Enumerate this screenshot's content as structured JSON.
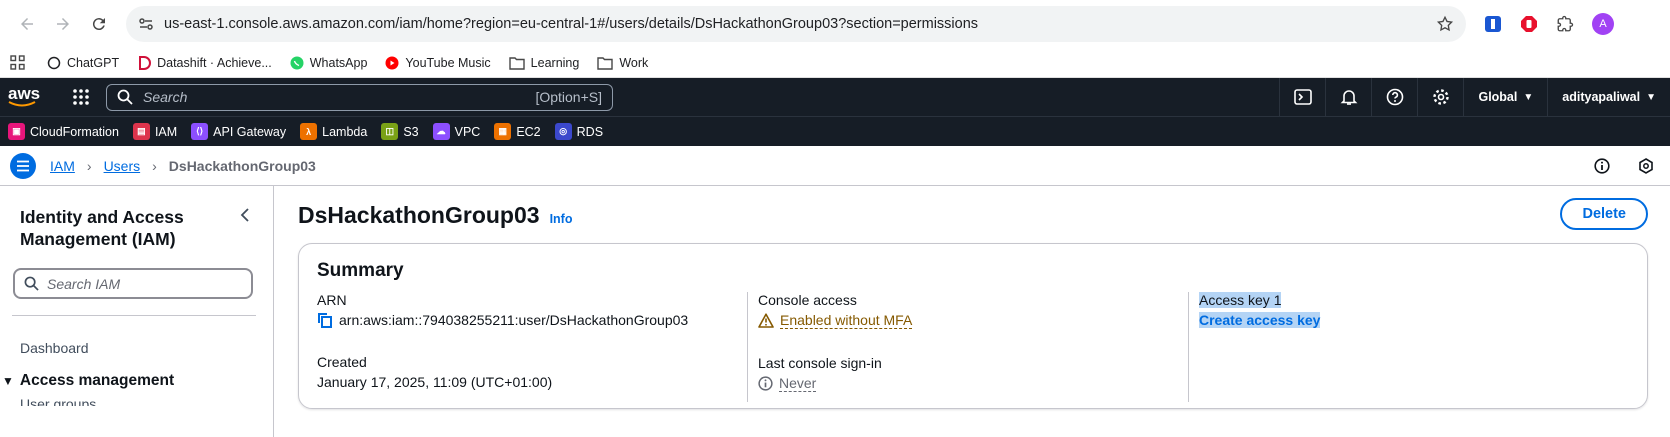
{
  "browser": {
    "url": "us-east-1.console.aws.amazon.com/iam/home?region=eu-central-1#/users/details/DsHackathonGroup03?section=permissions",
    "avatar_letter": "A"
  },
  "bookmarks": [
    "ChatGPT",
    "Datashift · Achieve...",
    "WhatsApp",
    "YouTube Music",
    "Learning",
    "Work"
  ],
  "aws": {
    "logo": "aws",
    "search_placeholder": "Search",
    "search_shortcut": "[Option+S]",
    "region": "Global",
    "user": "adityapaliwal",
    "favorites": [
      {
        "label": "CloudFormation",
        "color": "#e7157b"
      },
      {
        "label": "IAM",
        "color": "#dd344c"
      },
      {
        "label": "API Gateway",
        "color": "#8c4fff"
      },
      {
        "label": "Lambda",
        "color": "#ed7100"
      },
      {
        "label": "S3",
        "color": "#7aa116"
      },
      {
        "label": "VPC",
        "color": "#8c4fff"
      },
      {
        "label": "EC2",
        "color": "#ed7100"
      },
      {
        "label": "RDS",
        "color": "#3b48cc"
      }
    ]
  },
  "breadcrumb": {
    "items": [
      "IAM",
      "Users"
    ],
    "current": "DsHackathonGroup03"
  },
  "sidebar": {
    "title": "Identity and Access Management (IAM)",
    "search_placeholder": "Search IAM",
    "dashboard": "Dashboard",
    "section": "Access management",
    "sub_item": "User groups"
  },
  "page": {
    "title": "DsHackathonGroup03",
    "info": "Info",
    "delete_label": "Delete"
  },
  "summary": {
    "title": "Summary",
    "arn_label": "ARN",
    "arn_value": "arn:aws:iam::794038255211:user/DsHackathonGroup03",
    "created_label": "Created",
    "created_value": "January 17, 2025, 11:09 (UTC+01:00)",
    "console_label": "Console access",
    "console_value": "Enabled without MFA",
    "signin_label": "Last console sign-in",
    "signin_value": "Never",
    "key_label": "Access key 1",
    "key_action": "Create access key"
  }
}
